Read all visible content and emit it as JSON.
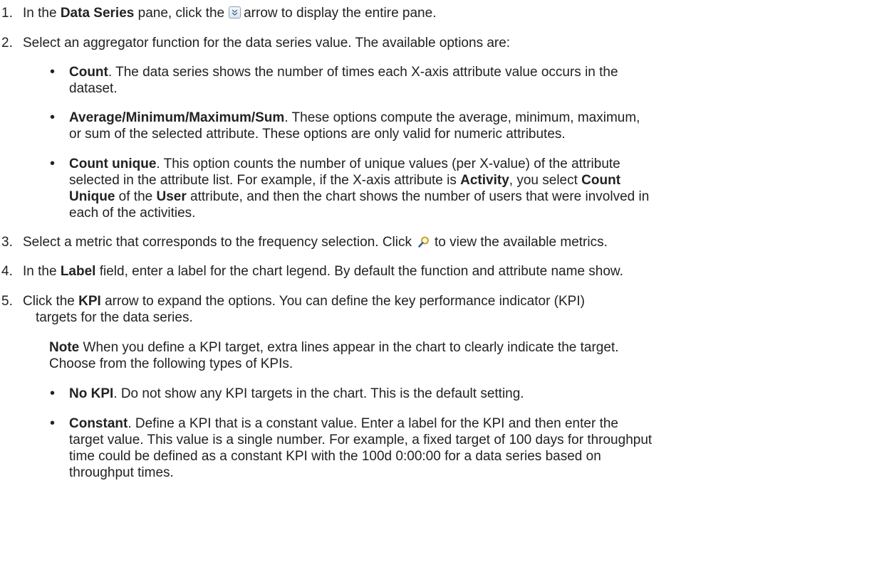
{
  "steps": [
    {
      "number": "1.",
      "before": "In the ",
      "bold": "Data Series",
      "after_bold": " pane, click the",
      "icon": "expand-arrow-icon",
      "after_icon": "arrow to display the entire pane."
    },
    {
      "number": "2.",
      "text": "Select an aggregator function for the data series value. The available options are:"
    },
    {
      "number": "3.",
      "before": "Select a metric that corresponds to the frequency selection. Click",
      "icon": "magnifier-icon",
      "after_icon": "to view the available metrics."
    },
    {
      "number": "4.",
      "before": "In the ",
      "bold": "Label",
      "after": " field, enter a label for the chart legend. By default the function and attribute name show."
    },
    {
      "number": "5.",
      "before": "Click the ",
      "bold": "KPI",
      "after_line1": " arrow to expand the options. You can define the key performance indicator (KPI)",
      "line2": "targets for the data series."
    }
  ],
  "aggregators": [
    {
      "term": "Count",
      "line1": ". The data series shows the number of times each X-axis attribute value occurs in the",
      "line2": "dataset."
    },
    {
      "term": "Average/Minimum/Maximum/Sum",
      "line1": ". These options compute the average, minimum, maximum,",
      "line2": "or sum of the selected attribute. These options are only valid for numeric attributes."
    },
    {
      "term": "Count unique",
      "line1": ". This option counts the number of unique values (per X-value) of the attribute",
      "line2_pre": "selected in the attribute list. For example, if the X-axis attribute is ",
      "line2_b1": "Activity",
      "line2_mid": ", you select ",
      "line2_b2": "Count",
      "line3_b1": "Unique",
      "line3_mid": " of the ",
      "line3_b2": "User",
      "line3_post": " attribute, and then the chart shows the number of users that were involved in",
      "line4": "each of the activities."
    }
  ],
  "note": {
    "label": "Note",
    "line1": " When you define a KPI target, extra lines appear in the chart to clearly indicate the target.",
    "line2": "Choose from the following types of KPIs."
  },
  "kpis": [
    {
      "term": "No KPI",
      "line1": ". Do not show any KPI targets in the chart. This is the default setting."
    },
    {
      "term": "Constant",
      "line1": ". Define a KPI that is a constant value. Enter a label for the KPI and then enter the",
      "line2": "target value. This value is a single number. For example, a fixed target of 100 days for throughput",
      "line3": "time could be defined as a constant KPI with the 100d 0:00:00 for a data series based on",
      "line4": "throughput times."
    }
  ],
  "bullet_char": "•"
}
